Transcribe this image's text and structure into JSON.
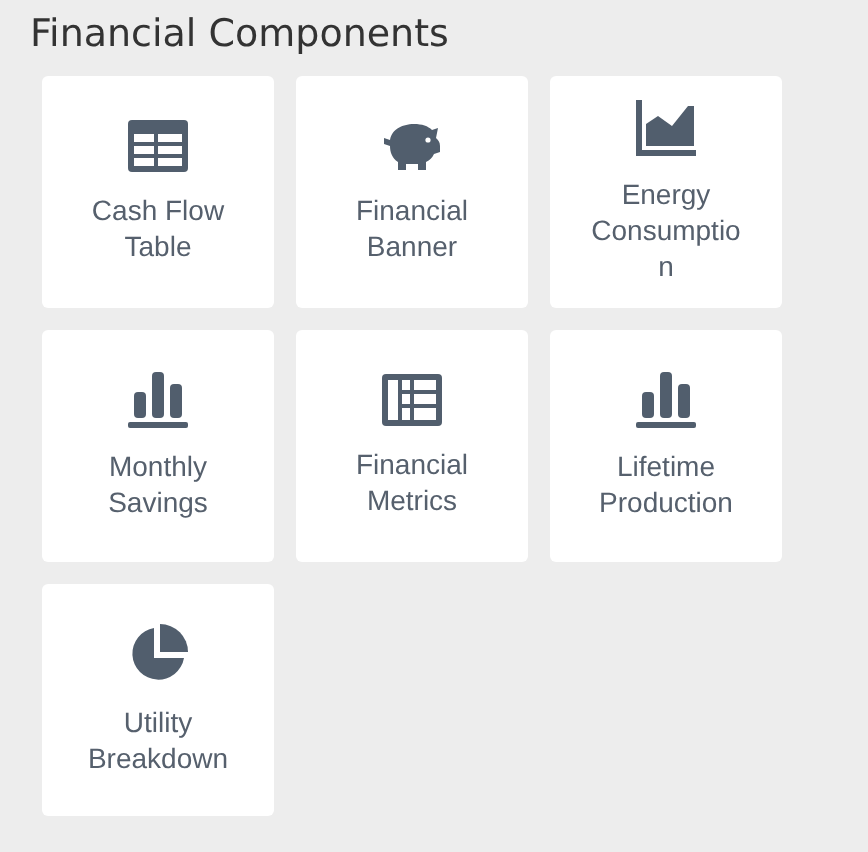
{
  "section": {
    "title": "Financial Components"
  },
  "components": [
    {
      "label": "Cash Flow Table",
      "kind": "table"
    },
    {
      "label": "Financial Banner",
      "kind": "piggy"
    },
    {
      "label": "Energy Consumption",
      "kind": "area"
    },
    {
      "label": "Monthly Savings",
      "kind": "bars"
    },
    {
      "label": "Financial Metrics",
      "kind": "list"
    },
    {
      "label": "Lifetime Production",
      "kind": "bars"
    },
    {
      "label": "Utility Breakdown",
      "kind": "pie"
    }
  ]
}
